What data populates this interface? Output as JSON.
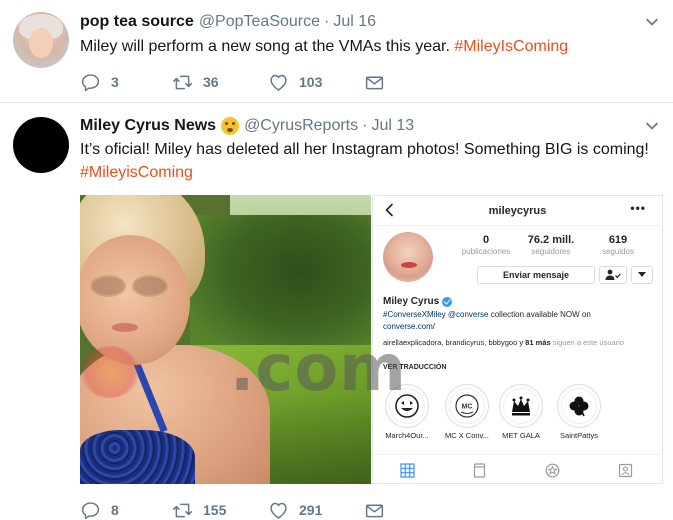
{
  "colors": {
    "hashtag": "#e0531f",
    "muted": "#657786",
    "name": "#14171a",
    "divider": "#e6ecf0",
    "instagram_verified": "#3897f0"
  },
  "tweets": [
    {
      "name": "pop tea source",
      "handle": "@PopTeaSource",
      "dot": "·",
      "date": "Jul 16",
      "text": "Miley will perform a new song at the VMAs this year.",
      "hashtag": "#MileyIsComing",
      "actions": {
        "reply": "3",
        "retweet": "36",
        "like": "103"
      }
    },
    {
      "name": "Miley Cyrus News",
      "emoji": "shushing-face-emoji",
      "handle": "@CyrusReports",
      "dot": "·",
      "date": "Jul 13",
      "text": "It’s oficial! Miley has deleted all her Instagram photos! Something BIG is coming!",
      "hashtag": "#MileyisComing",
      "actions": {
        "reply": "8",
        "retweet": "155",
        "like": "291"
      }
    }
  ],
  "instagram": {
    "username": "mileycyrus",
    "more": "•••",
    "stats": [
      {
        "number": "0",
        "label": "publicaciones"
      },
      {
        "number": "76.2 mill.",
        "label": "seguidores"
      },
      {
        "number": "619",
        "label": "seguidos"
      }
    ],
    "message_button": "Enviar mensaje",
    "profile_name": "Miley Cyrus",
    "bio_tag": "#ConverseXMiley @converse",
    "bio_rest": " collection available NOW on",
    "bio_link": "converse.com/",
    "followers_prefix": "airellaexplicadora, brandicyrus, bbbygoo",
    "followers_mid": " y ",
    "followers_bold": "81 más",
    "followers_suffix": " siguen a este usuario",
    "translate": "VER TRADUCCIÓN",
    "highlights": [
      {
        "label": "March4Our...",
        "icon": "smiley-icon"
      },
      {
        "label": "MC X Conv...",
        "icon": "mc-badge-icon"
      },
      {
        "label": "MET GALA",
        "icon": "crown-icon"
      },
      {
        "label": "SaintPattys",
        "icon": "clover-icon"
      }
    ]
  },
  "watermark": ".com"
}
